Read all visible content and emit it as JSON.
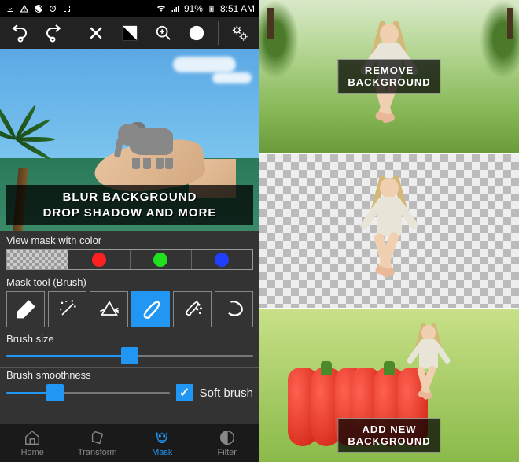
{
  "status": {
    "battery_pct": "91%",
    "time": "8:51 AM"
  },
  "canvas_promo": {
    "line1": "BLUR BACKGROUND",
    "line2": "DROP SHADOW AND MORE"
  },
  "mask_color": {
    "label": "View mask with color",
    "colors": [
      "#ff2020",
      "#20e020",
      "#2040ff"
    ]
  },
  "mask_tool": {
    "label": "Mask tool (Brush)",
    "tools": [
      "eraser",
      "magic-wand",
      "prism",
      "brush",
      "brush-sparkle",
      "lasso"
    ],
    "active_index": 3
  },
  "brush_size": {
    "label": "Brush size",
    "value": 50
  },
  "brush_smoothness": {
    "label": "Brush smoothness",
    "value": 30
  },
  "soft_brush": {
    "label": "Soft brush",
    "checked": true
  },
  "nav": {
    "items": [
      {
        "label": "Home"
      },
      {
        "label": "Transform"
      },
      {
        "label": "Mask"
      },
      {
        "label": "Filter"
      }
    ],
    "active_index": 2
  },
  "right": {
    "remove_label": "REMOVE\nBACKGROUND",
    "add_label": "ADD NEW\nBACKGROUND"
  }
}
